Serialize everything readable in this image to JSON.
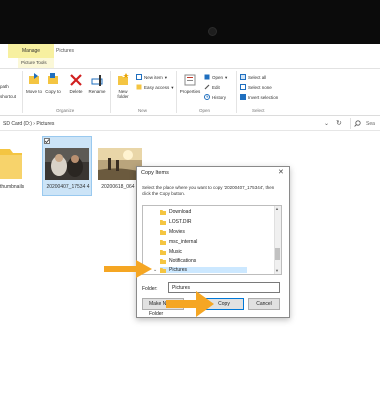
{
  "top_context": {
    "manage_tab": "Manage",
    "location_tab": "Pictures",
    "tools_tab": "Picture Tools"
  },
  "ribbon": {
    "path_stub": "path",
    "shortcut_stub": "shortcut",
    "move_to": "Move to",
    "copy_to": "Copy to",
    "delete": "Delete",
    "rename": "Rename",
    "new_folder": "New folder",
    "new_item": "New item",
    "easy_access": "Easy access",
    "properties": "Properties",
    "open": "Open",
    "edit": "Edit",
    "history": "History",
    "select_all": "Select all",
    "select_none": "Select none",
    "invert_selection": "Invert selection",
    "groups": [
      "Organize",
      "New",
      "Open",
      "Select"
    ]
  },
  "address_bar": {
    "path": "SD Card (D:)  ›  Pictures",
    "search_placeholder": "Sea"
  },
  "files": [
    {
      "name": "thumbnails"
    },
    {
      "name": "20200407_17534 4"
    },
    {
      "name": "20200618_064 0"
    }
  ],
  "dialog": {
    "title": "Copy Items",
    "instruction": "Select the place where you want to copy '20200407_175344', then click the Copy button.",
    "tree": [
      "Download",
      "LOST.DIR",
      "Movies",
      "msc_internal",
      "Music",
      "Notifications",
      "Pictures"
    ],
    "selected_folder": "Pictures",
    "folder_label": "Folder:",
    "folder_value": "Pictures",
    "make_new_folder": "Make New Folder",
    "copy_button": "Copy",
    "cancel_button": "Cancel"
  },
  "colors": {
    "accent": "#0078d7",
    "manage_highlight": "#f7f0a0",
    "selection": "#cce4f7",
    "arrow": "#f5a623",
    "folder": "#f4c542"
  }
}
